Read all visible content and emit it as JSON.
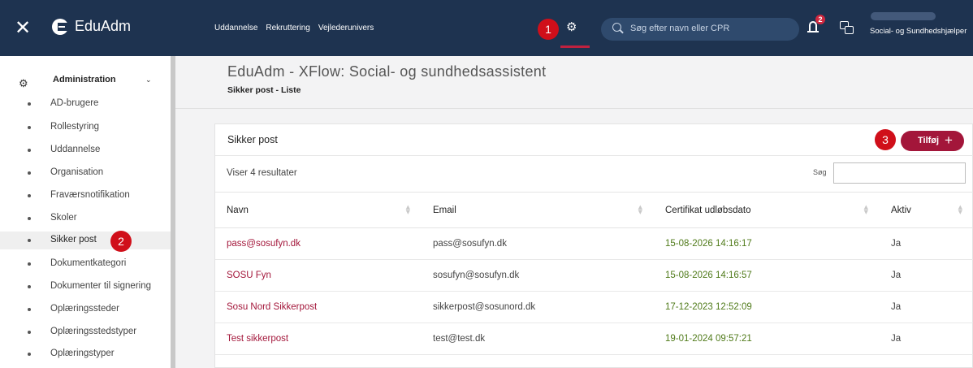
{
  "header": {
    "brand": "EduAdm",
    "nav": [
      "Uddannelse",
      "Rekruttering",
      "Vejlederunivers"
    ],
    "search_placeholder": "Søg efter navn eller CPR",
    "notification_count": "2",
    "user_role": "Social- og Sundhedshjælper"
  },
  "sidebar": {
    "section_title": "Administration",
    "items": [
      {
        "label": "AD-brugere"
      },
      {
        "label": "Rollestyring"
      },
      {
        "label": "Uddannelse"
      },
      {
        "label": "Organisation"
      },
      {
        "label": "Fraværsnotifikation"
      },
      {
        "label": "Skoler"
      },
      {
        "label": "Sikker post"
      },
      {
        "label": "Dokumentkategori"
      },
      {
        "label": "Dokumenter til signering"
      },
      {
        "label": "Oplæringssteder"
      },
      {
        "label": "Oplæringsstedstyper"
      },
      {
        "label": "Oplæringstyper"
      }
    ]
  },
  "page": {
    "title": "EduAdm - XFlow: Social- og sundhedsassistent",
    "breadcrumb": "Sikker post - Liste"
  },
  "card": {
    "title": "Sikker post",
    "add_label": "Tilføj",
    "add_plus": "+",
    "result_count": "Viser 4 resultater",
    "search_label": "Søg"
  },
  "table": {
    "columns": [
      "Navn",
      "Email",
      "Certifikat udløbsdato",
      "Aktiv"
    ],
    "rows": [
      {
        "name": "pass@sosufyn.dk",
        "email": "pass@sosufyn.dk",
        "cert": "15-08-2026 14:16:17",
        "active": "Ja"
      },
      {
        "name": "SOSU Fyn",
        "email": "sosufyn@sosufyn.dk",
        "cert": "15-08-2026 14:16:57",
        "active": "Ja"
      },
      {
        "name": "Sosu Nord Sikkerpost",
        "email": "sikkerpost@sosunord.dk",
        "cert": "17-12-2023 12:52:09",
        "active": "Ja"
      },
      {
        "name": "Test sikkerpost",
        "email": "test@test.dk",
        "cert": "19-01-2024 09:57:21",
        "active": "Ja"
      }
    ]
  },
  "markers": [
    "1",
    "2",
    "3"
  ],
  "colors": {
    "header_bg": "#1e3350",
    "accent": "#a3163a",
    "marker": "#d00f1a",
    "cert_text": "#4f7a19"
  }
}
